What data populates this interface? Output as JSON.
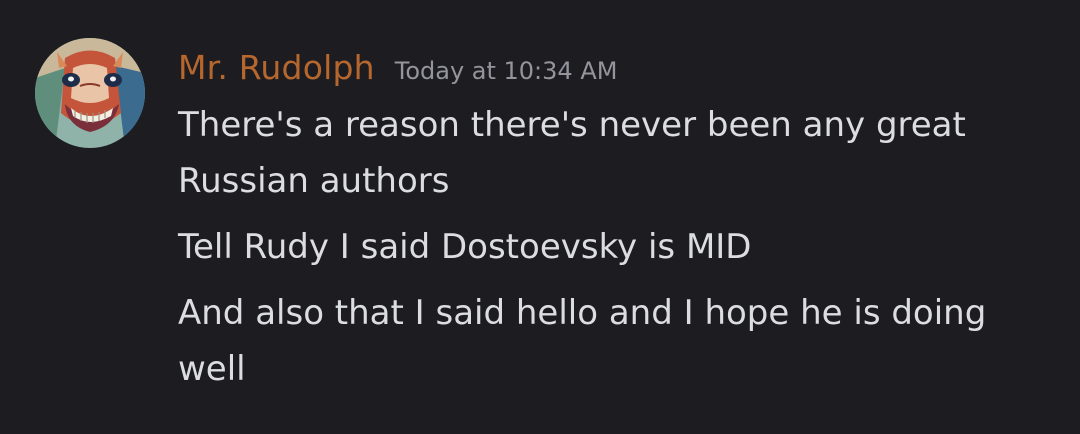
{
  "author": {
    "name": "Mr. Rudolph",
    "name_color": "#b5672e",
    "avatar_icon": "horse-painting-avatar"
  },
  "timestamp": "Today at 10:34 AM",
  "messages": [
    {
      "text": "There's a reason there's never been any great Russian authors"
    },
    {
      "text": "Tell Rudy I said Dostoevsky is MID"
    },
    {
      "text": "And also that I said hello and I hope he is doing well"
    }
  ],
  "colors": {
    "background": "#1c1c21",
    "message_text": "#dcdde1",
    "timestamp_text": "#94949c"
  }
}
